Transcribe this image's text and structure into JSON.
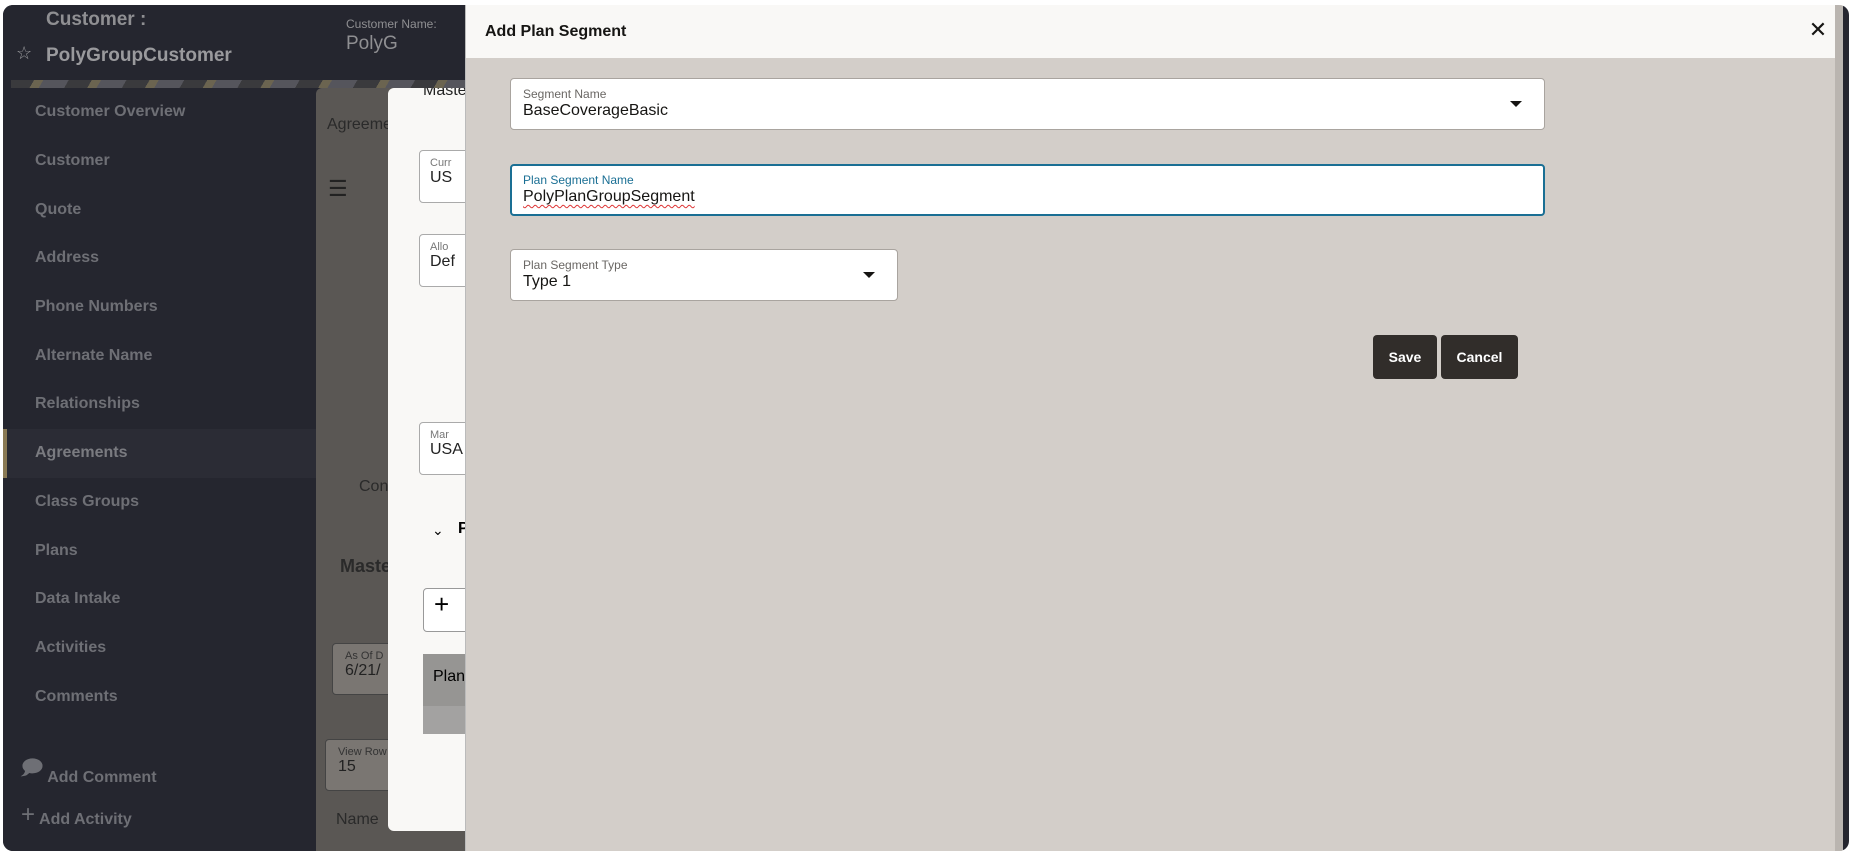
{
  "header": {
    "customer_label": "Customer :",
    "customer_name": "PolyGroupCustomer",
    "customer_name_label": "Customer Name:",
    "customer_name_value": "PolyG"
  },
  "sidebar": {
    "items": [
      {
        "label": "Customer Overview"
      },
      {
        "label": "Customer"
      },
      {
        "label": "Quote"
      },
      {
        "label": "Address"
      },
      {
        "label": "Phone Numbers"
      },
      {
        "label": "Alternate Name"
      },
      {
        "label": "Relationships"
      },
      {
        "label": "Agreements",
        "active": true
      },
      {
        "label": "Class Groups"
      },
      {
        "label": "Plans"
      },
      {
        "label": "Data Intake"
      },
      {
        "label": "Activities"
      },
      {
        "label": "Comments"
      }
    ],
    "actions": [
      {
        "label": "Add Comment",
        "icon": "comment-add-icon"
      },
      {
        "label": "Add Activity",
        "icon": "plus-icon"
      }
    ]
  },
  "background": {
    "tab": "Agreeme",
    "tab2": "Con",
    "section": "Maste",
    "as_of_label": "As Of D",
    "as_of_value": "6/21/",
    "view_rows_label": "View Row",
    "view_rows_value": "15",
    "col_name": "Name"
  },
  "middle_dialog": {
    "title": "Maste",
    "currency_label": "Curr",
    "currency_value": "US",
    "alloc_label": "Allo",
    "alloc_value": "Def",
    "market_label": "Mar",
    "market_value": "USA",
    "section": "P",
    "plan_col": "Plan"
  },
  "dialog": {
    "title": "Add Plan Segment",
    "segment_name": {
      "label": "Segment Name",
      "value": "BaseCoverageBasic"
    },
    "plan_segment_name": {
      "label": "Plan Segment Name",
      "value": "PolyPlanGroupSegment"
    },
    "plan_segment_type": {
      "label": "Plan Segment Type",
      "value": "Type 1"
    },
    "save_label": "Save",
    "cancel_label": "Cancel"
  },
  "colors": {
    "sidebar": "#25262f",
    "dialog_body": "#d3cec9",
    "focus": "#1a6f94",
    "button": "#312d2a"
  }
}
